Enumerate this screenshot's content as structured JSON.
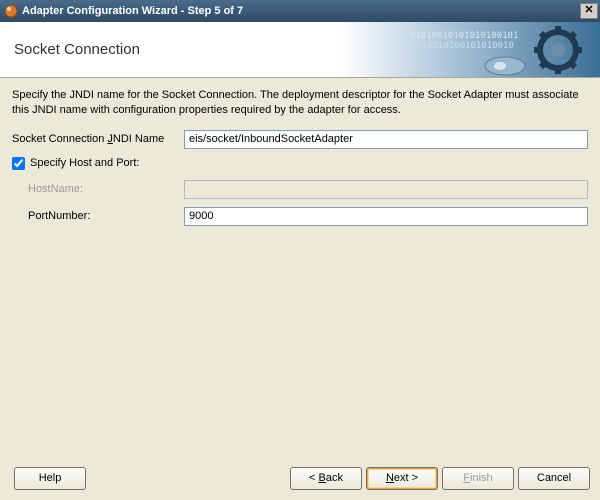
{
  "window": {
    "title": "Adapter Configuration Wizard - Step 5 of 7",
    "close_glyph": "✕"
  },
  "header": {
    "title": "Socket Connection"
  },
  "intro": "Specify the JNDI name for the Socket Connection.  The deployment descriptor for the Socket Adapter must associate this JNDI name with configuration properties required by the adapter for access.",
  "fields": {
    "jndi_label_pre": "Socket Connection ",
    "jndi_label_key": "J",
    "jndi_label_post": "NDI Name",
    "jndi_value": "eis/socket/InboundSocketAdapter",
    "chk_label": "Specify Host and Port:",
    "host_label": "HostName:",
    "host_value": "",
    "port_label": "PortNumber:",
    "port_value": "9000"
  },
  "buttons": {
    "help": "Help",
    "back_pre": "< ",
    "back_key": "B",
    "back_post": "ack",
    "next_key": "N",
    "next_post": "ext >",
    "finish_key": "F",
    "finish_post": "inish",
    "cancel": "Cancel"
  }
}
